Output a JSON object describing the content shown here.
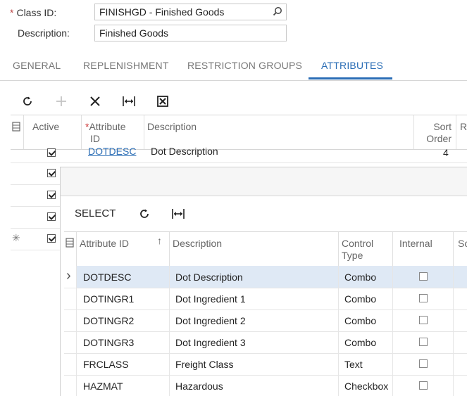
{
  "form": {
    "class_id_label": "Class ID:",
    "class_id_required": "*",
    "class_id_value": "FINISHGD - Finished Goods",
    "description_label": "Description:",
    "description_value": "Finished Goods"
  },
  "tabs": [
    {
      "label": "GENERAL",
      "active": false
    },
    {
      "label": "REPLENISHMENT",
      "active": false
    },
    {
      "label": "RESTRICTION GROUPS",
      "active": false
    },
    {
      "label": "ATTRIBUTES",
      "active": true
    }
  ],
  "toolbar": {
    "icons": [
      "refresh-icon",
      "add-icon",
      "delete-icon",
      "fit-columns-icon",
      "export-excel-icon"
    ]
  },
  "grid": {
    "columns": {
      "active": "Active",
      "attribute_id_required": "*",
      "attribute_id_line1": "Attribute",
      "attribute_id_line2": "ID",
      "description": "Description",
      "sort_order_line1": "Sort",
      "sort_order_line2": "Order",
      "next_col": "R"
    },
    "rows": [
      {
        "active": true,
        "attribute_id": "DOTDESC",
        "description": "Dot Description",
        "sort_order": "4"
      },
      {
        "active": true
      },
      {
        "active": true
      },
      {
        "active": true
      },
      {
        "active": true,
        "new_row_marker": "✳"
      }
    ]
  },
  "popup": {
    "select_label": "SELECT",
    "columns": {
      "attribute_id": "Attribute ID",
      "sort_indicator": "↑",
      "description": "Description",
      "control_type_line1": "Control",
      "control_type_line2": "Type",
      "internal": "Internal",
      "next_col": "Sc"
    },
    "row_indicator": "›",
    "rows": [
      {
        "attribute_id": "DOTDESC",
        "description": "Dot Description",
        "control_type": "Combo",
        "internal": false
      },
      {
        "attribute_id": "DOTINGR1",
        "description": "Dot Ingredient 1",
        "control_type": "Combo",
        "internal": false
      },
      {
        "attribute_id": "DOTINGR2",
        "description": "Dot Ingredient 2",
        "control_type": "Combo",
        "internal": false
      },
      {
        "attribute_id": "DOTINGR3",
        "description": "Dot Ingredient 3",
        "control_type": "Combo",
        "internal": false
      },
      {
        "attribute_id": "FRCLASS",
        "description": "Freight Class",
        "control_type": "Text",
        "internal": false
      },
      {
        "attribute_id": "HAZMAT",
        "description": "Hazardous",
        "control_type": "Checkbox",
        "internal": false
      }
    ]
  },
  "colors": {
    "accent": "#2a6db5",
    "selected_row": "#dfe9f5"
  }
}
